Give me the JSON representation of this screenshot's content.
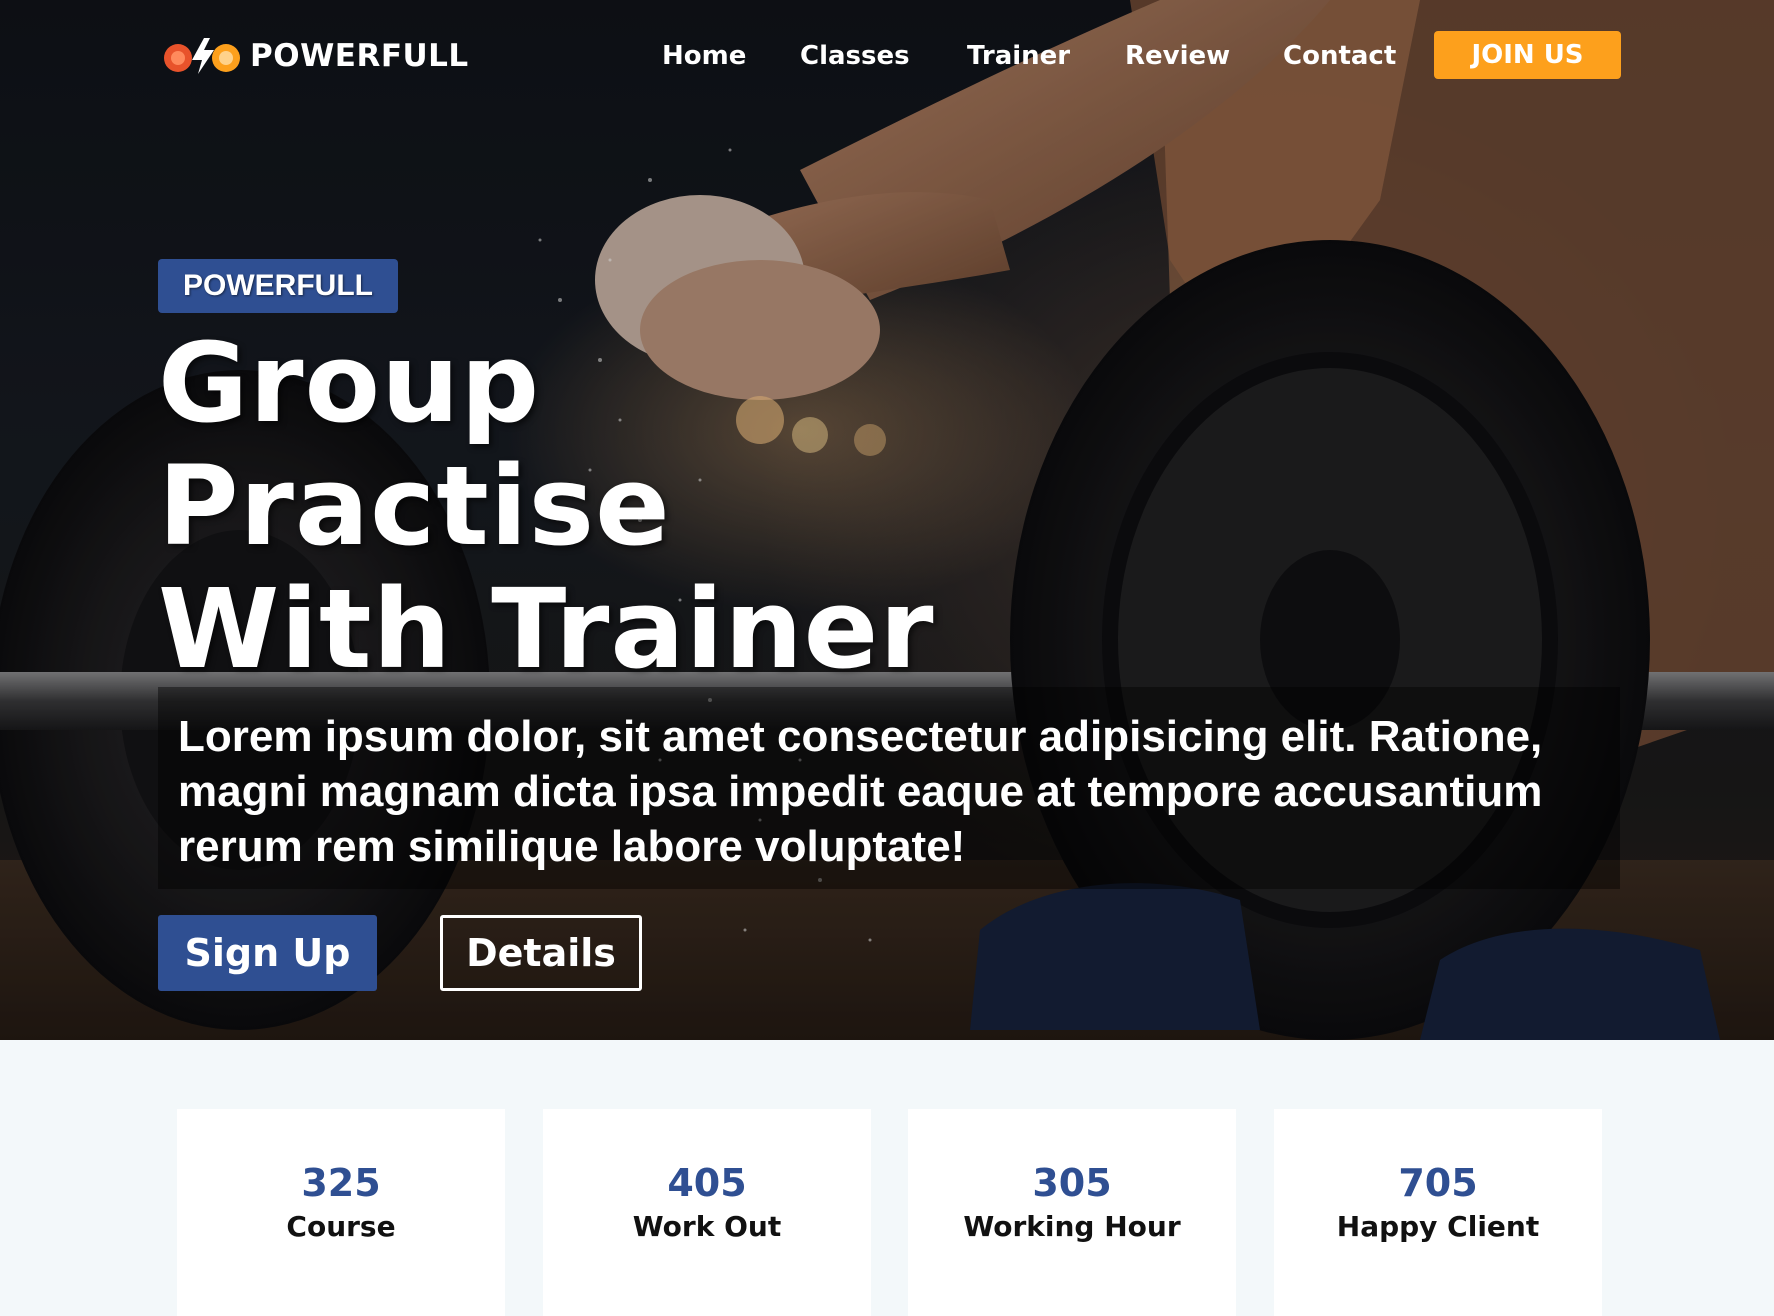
{
  "brand": {
    "name": "POWERFULL",
    "icon": "dumbbell-bolt-logo"
  },
  "nav": {
    "links": [
      "Home",
      "Classes",
      "Trainer",
      "Review",
      "Contact"
    ],
    "cta": "JOIN US"
  },
  "hero": {
    "badge": "POWERFULL",
    "headline": [
      "Group",
      "Practise",
      "With Trainer"
    ],
    "description": "Lorem ipsum dolor, sit amet consectetur adipisicing elit. Ratione, magni magnam dicta ipsa impedit eaque at tempore accusantium rerum rem similique labore voluptate!",
    "primary_button": "Sign Up",
    "secondary_button": "Details"
  },
  "stats": [
    {
      "value": "325",
      "label": "Course"
    },
    {
      "value": "405",
      "label": "Work Out"
    },
    {
      "value": "305",
      "label": "Working Hour"
    },
    {
      "value": "705",
      "label": "Happy Client"
    }
  ],
  "colors": {
    "accent_orange": "#fda01c",
    "brand_blue": "#2f4f92",
    "section_bg": "#f3f8fa"
  }
}
